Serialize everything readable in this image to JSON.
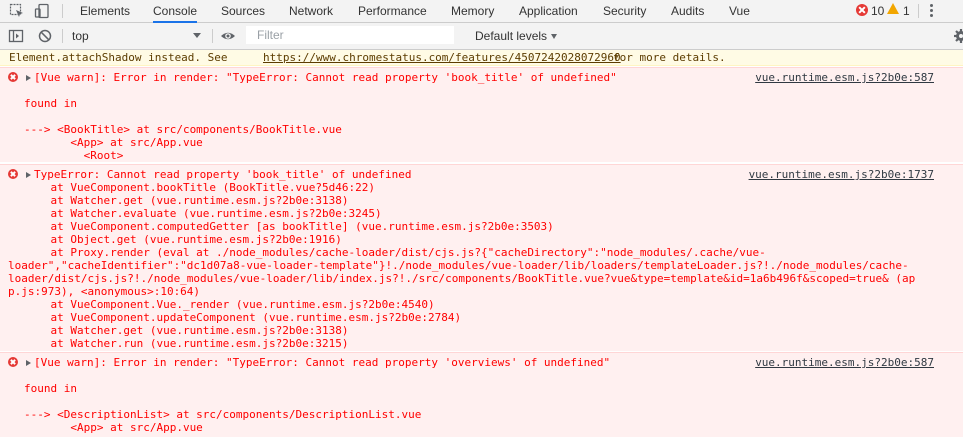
{
  "tabs": [
    "Elements",
    "Console",
    "Sources",
    "Network",
    "Performance",
    "Memory",
    "Application",
    "Security",
    "Audits",
    "Vue"
  ],
  "error_count": "10",
  "warning_count": "1",
  "toolbar": {
    "context": "top",
    "filter_placeholder": "Filter",
    "levels": "Default levels"
  },
  "prev_line": {
    "text": "Element.attachShadow instead. See",
    "link": "https://www.chromestatus.com/features/4507242028072960",
    "after": "for more details."
  },
  "messages": [
    {
      "source": "vue.runtime.esm.js?2b0e:587",
      "lines": [
        "[Vue warn]: Error in render: \"TypeError: Cannot read property 'book_title' of undefined\"",
        "",
        "found in",
        "",
        "---> <BookTitle> at src/components/BookTitle.vue",
        "       <App> at src/App.vue",
        "         <Root>"
      ]
    },
    {
      "source": "vue.runtime.esm.js?2b0e:1737",
      "lines": [
        "TypeError: Cannot read property 'book_title' of undefined",
        "    at VueComponent.bookTitle (BookTitle.vue?5d46:22)",
        "    at Watcher.get (vue.runtime.esm.js?2b0e:3138)",
        "    at Watcher.evaluate (vue.runtime.esm.js?2b0e:3245)",
        "    at VueComponent.computedGetter [as bookTitle] (vue.runtime.esm.js?2b0e:3503)",
        "    at Object.get (vue.runtime.esm.js?2b0e:1916)",
        "    at Proxy.render (eval at ./node_modules/cache-loader/dist/cjs.js?{\"cacheDirectory\":\"node_modules/.cache/vue-",
        "loader\",\"cacheIdentifier\":\"dc1d07a8-vue-loader-template\"}!./node_modules/vue-loader/lib/loaders/templateLoader.js?!./node_modules/cache-",
        "loader/dist/cjs.js?!./node_modules/vue-loader/lib/index.js?!./src/components/BookTitle.vue?vue&type=template&id=1a6b496f&scoped=true& (ap",
        "p.js:973), <anonymous>:10:64)",
        "    at VueComponent.Vue._render (vue.runtime.esm.js?2b0e:4540)",
        "    at VueComponent.updateComponent (vue.runtime.esm.js?2b0e:2784)",
        "    at Watcher.get (vue.runtime.esm.js?2b0e:3138)",
        "    at Watcher.run (vue.runtime.esm.js?2b0e:3215)"
      ]
    },
    {
      "source": "vue.runtime.esm.js?2b0e:587",
      "lines": [
        "[Vue warn]: Error in render: \"TypeError: Cannot read property 'overviews' of undefined\"",
        "",
        "found in",
        "",
        "---> <DescriptionList> at src/components/DescriptionList.vue",
        "       <App> at src/App.vue"
      ]
    }
  ]
}
